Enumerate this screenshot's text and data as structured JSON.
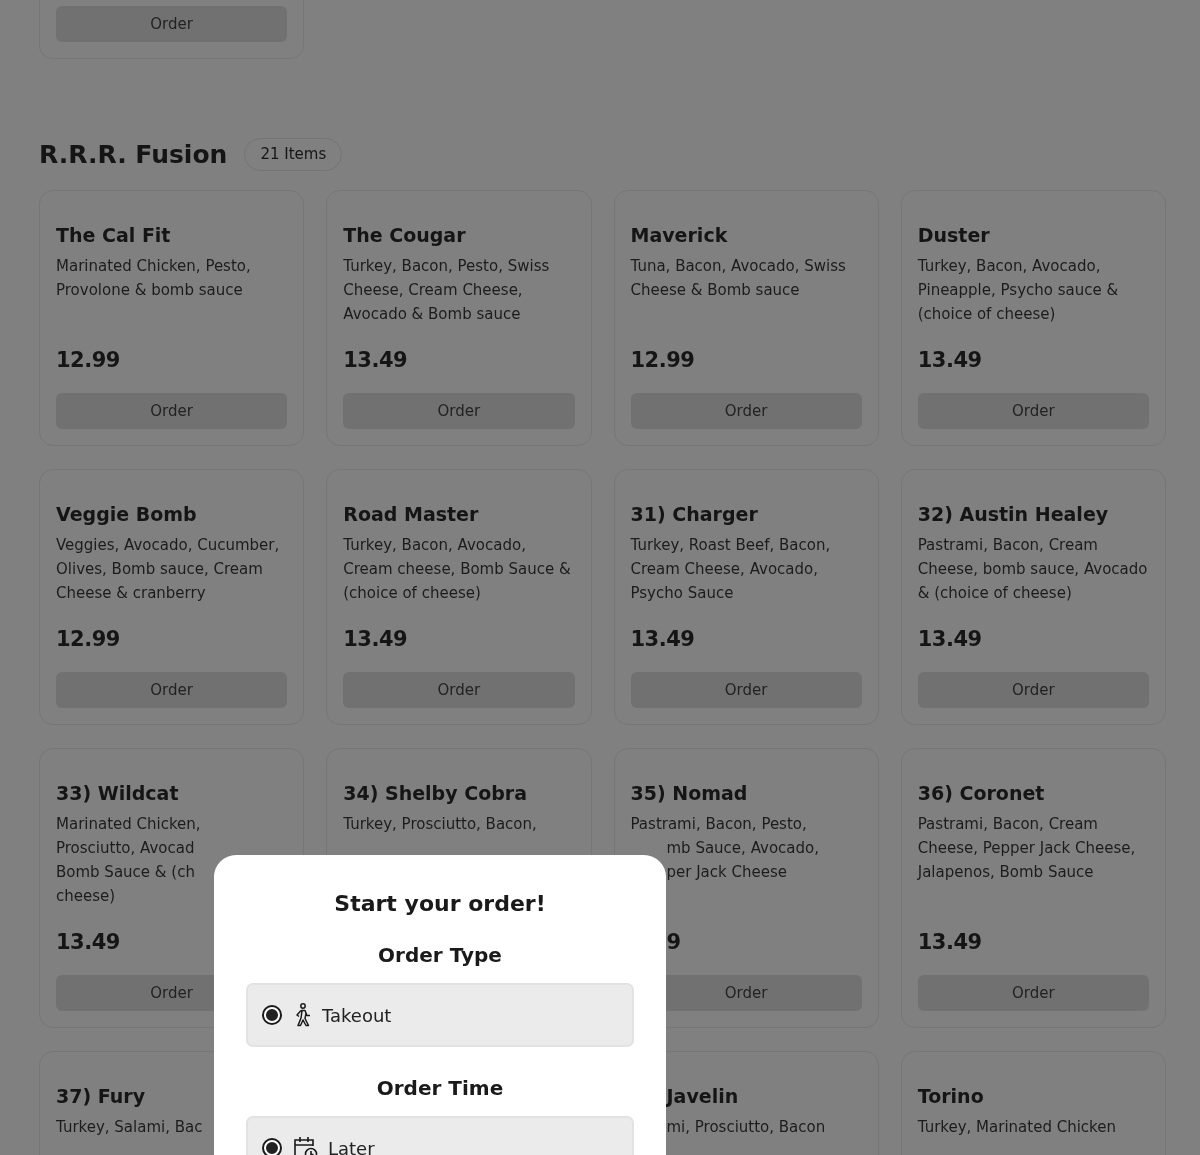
{
  "previous_section": {
    "order_button": "Order"
  },
  "section": {
    "title": "R.R.R. Fusion",
    "count": "21 Items",
    "items": [
      {
        "name": "The Cal Fit",
        "description": "Marinated Chicken, Pesto, Provolone & bomb sauce",
        "price": "12.99",
        "button": "Order"
      },
      {
        "name": "The Cougar",
        "description": "Turkey, Bacon, Pesto, Swiss Cheese, Cream Cheese, Avocado & Bomb sauce",
        "price": "13.49",
        "button": "Order"
      },
      {
        "name": "Maverick",
        "description": "Tuna, Bacon, Avocado, Swiss Cheese & Bomb sauce",
        "price": "12.99",
        "button": "Order"
      },
      {
        "name": "Duster",
        "description": "Turkey, Bacon, Avocado, Pineapple, Psycho sauce & (choice of cheese)",
        "price": "13.49",
        "button": "Order"
      },
      {
        "name": "Veggie Bomb",
        "description": "Veggies, Avocado, Cucumber, Olives, Bomb sauce, Cream Cheese & cranberry",
        "price": "12.99",
        "button": "Order"
      },
      {
        "name": "Road Master",
        "description": "Turkey, Bacon, Avocado, Cream cheese, Bomb Sauce & (choice of cheese)",
        "price": "13.49",
        "button": "Order"
      },
      {
        "name": "31) Charger",
        "description": "Turkey, Roast Beef, Bacon, Cream Cheese, Avocado, Psycho Sauce",
        "price": "13.49",
        "button": "Order"
      },
      {
        "name": "32) Austin Healey",
        "description": "Pastrami, Bacon, Cream Cheese, bomb sauce, Avocado & (choice of cheese)",
        "price": "13.49",
        "button": "Order"
      },
      {
        "name": "33) Wildcat",
        "description": "Marinated Chicken,\nProsciutto, Avocad\nBomb Sauce & (ch\ncheese)",
        "price": "13.49",
        "button": "Order"
      },
      {
        "name": "34) Shelby Cobra",
        "description": "Turkey, Prosciutto, Bacon,"
      },
      {
        "name": "35) Nomad",
        "description": "Pastrami, Bacon, Pesto,\nmb Sauce, Avocado,\nper Jack Cheese",
        "price": "9",
        "button": "Order"
      },
      {
        "name": "36) Coronet",
        "description": "Pastrami, Bacon, Cream Cheese, Pepper Jack Cheese, Jalapenos, Bomb Sauce",
        "price": "13.49",
        "button": "Order"
      },
      {
        "name": "37) Fury",
        "description": "Turkey, Salami, Bac"
      },
      {
        "name": "Javelin",
        "description": "mi, Prosciutto, Bacon"
      },
      {
        "name": "Torino",
        "description": "Turkey, Marinated Chicken"
      }
    ]
  },
  "modal": {
    "title": "Start your order!",
    "groups": [
      {
        "heading": "Order Type",
        "options": [
          {
            "label": "Takeout",
            "kind": "walk",
            "selected": true
          }
        ]
      },
      {
        "heading": "Order Time",
        "options": [
          {
            "label": "Later",
            "kind": "schedule",
            "selected": true
          }
        ]
      }
    ]
  }
}
